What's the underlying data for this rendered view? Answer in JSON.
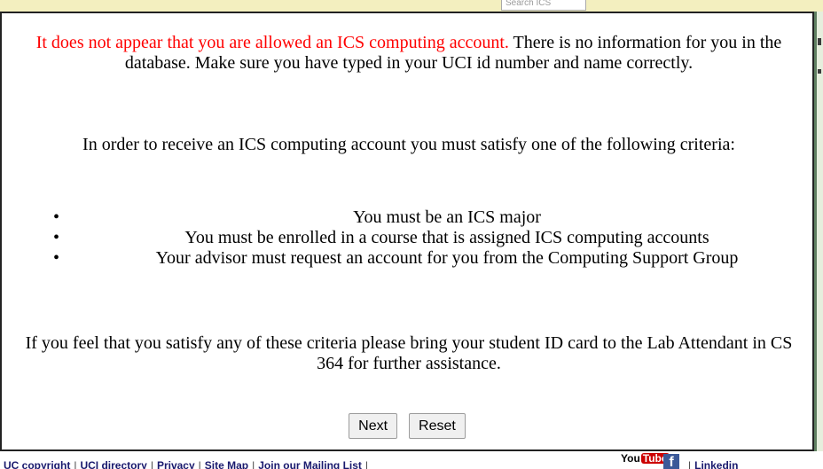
{
  "header": {
    "search_placeholder": "Search ICS"
  },
  "message": {
    "error_text": "It does not appear that you are allowed an ICS computing account.",
    "error_detail": "There is no information for you in the database. Make sure you have typed in your UCI id number and name correctly.",
    "requirement_intro": "In order to receive an ICS computing account you must satisfy one of the following criteria:",
    "criteria": [
      "You must be an ICS major",
      "You must be enrolled in a course that is assigned ICS computing accounts",
      "Your advisor must request an account for you from the Computing Support Group"
    ],
    "help_text": "If you feel that you satisfy any of these criteria please bring your student ID card to the Lab Attendant in CS 364 for further assistance."
  },
  "actions": {
    "next_label": "Next",
    "reset_label": "Reset"
  },
  "footer": {
    "links": [
      "UC copyright",
      "UCI directory",
      "Privacy",
      "Site Map",
      "Join our Mailing List"
    ],
    "youtube_label": "You",
    "youtube_tube": "Tube",
    "facebook_label": "f",
    "tail_link": "Linkedin"
  },
  "colors": {
    "error": "#ff0000",
    "top_band": "#f3efbf",
    "side_strip": "#e6eedd",
    "footer_link": "#1a1a6e",
    "facebook": "#3b5998",
    "youtube": "#cc0000"
  }
}
